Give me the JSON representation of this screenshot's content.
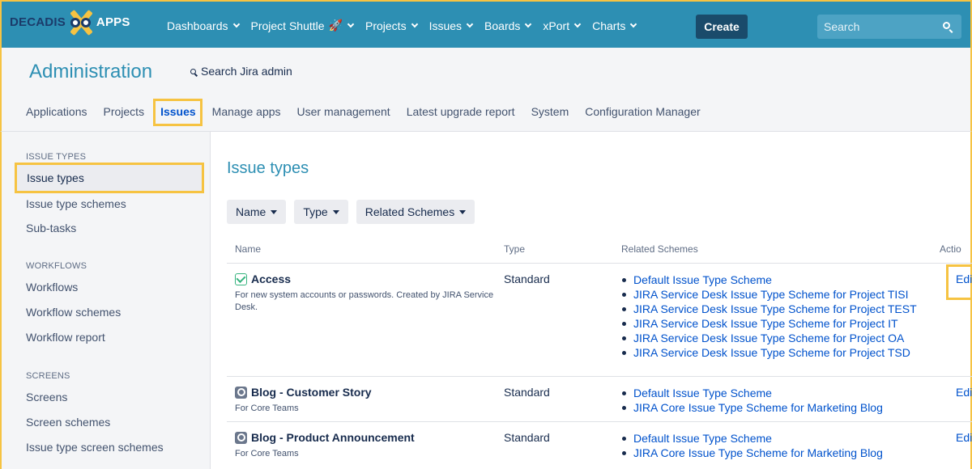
{
  "topnav": {
    "logo": {
      "word1": "DECADIS",
      "word2": "APPS"
    },
    "items": [
      {
        "label": "Dashboards"
      },
      {
        "label": "Project Shuttle"
      },
      {
        "label": "Projects"
      },
      {
        "label": "Issues"
      },
      {
        "label": "Boards"
      },
      {
        "label": "xPort"
      },
      {
        "label": "Charts"
      }
    ],
    "rocket": "🚀",
    "create_label": "Create",
    "search_placeholder": "Search"
  },
  "admin": {
    "title": "Administration",
    "search_label": "Search Jira admin",
    "tabs": [
      {
        "label": "Applications"
      },
      {
        "label": "Projects"
      },
      {
        "label": "Issues",
        "active": true
      },
      {
        "label": "Manage apps"
      },
      {
        "label": "User management"
      },
      {
        "label": "Latest upgrade report"
      },
      {
        "label": "System"
      },
      {
        "label": "Configuration Manager"
      }
    ]
  },
  "sidebar": {
    "sections": [
      {
        "heading": "ISSUE TYPES",
        "items": [
          "Issue types",
          "Issue type schemes",
          "Sub-tasks"
        ]
      },
      {
        "heading": "WORKFLOWS",
        "items": [
          "Workflows",
          "Workflow schemes",
          "Workflow report"
        ]
      },
      {
        "heading": "SCREENS",
        "items": [
          "Screens",
          "Screen schemes",
          "Issue type screen schemes"
        ]
      }
    ]
  },
  "main": {
    "title": "Issue types",
    "filters": [
      "Name",
      "Type",
      "Related Schemes"
    ],
    "columns": {
      "name": "Name",
      "type": "Type",
      "schemes": "Related Schemes",
      "actions": "Actio"
    },
    "rows": [
      {
        "name": "Access",
        "icon": "checkbox-icon",
        "description": "For new system accounts or passwords. Created by JIRA Service Desk.",
        "type": "Standard",
        "schemes": [
          "Default Issue Type Scheme",
          "JIRA Service Desk Issue Type Scheme for Project TISI",
          "JIRA Service Desk Issue Type Scheme for Project TEST",
          "JIRA Service Desk Issue Type Scheme for Project IT",
          "JIRA Service Desk Issue Type Scheme for Project OA",
          "JIRA Service Desk Issue Type Scheme for Project TSD"
        ],
        "action": "Edit"
      },
      {
        "name": "Blog - Customer Story",
        "icon": "blog-icon",
        "description": "For Core Teams",
        "type": "Standard",
        "schemes": [
          "Default Issue Type Scheme",
          "JIRA Core Issue Type Scheme for Marketing Blog"
        ],
        "action": "Edit"
      },
      {
        "name": "Blog - Product Announcement",
        "icon": "blog-icon",
        "description": "For Core Teams",
        "type": "Standard",
        "schemes": [
          "Default Issue Type Scheme",
          "JIRA Core Issue Type Scheme for Marketing Blog"
        ],
        "action": "Edit"
      }
    ]
  },
  "colors": {
    "brand": "#2d8fb3",
    "highlight": "#f6c342",
    "link": "#0052cc"
  }
}
